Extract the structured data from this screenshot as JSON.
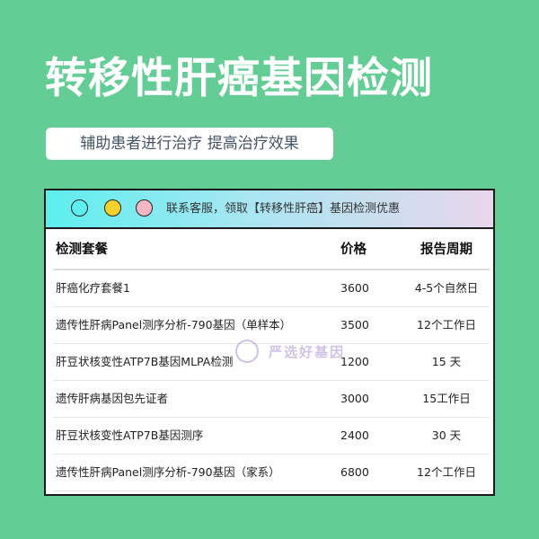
{
  "title": "转移性肝癌基因检测",
  "subtitle": "辅助患者进行治疗 提高治疗效果",
  "window": {
    "bar_text": "联系客服，领取【转移性肝癌】基因检测优惠"
  },
  "table": {
    "headers": [
      "检测套餐",
      "价格",
      "报告周期"
    ],
    "rows": [
      [
        "肝癌化疗套餐1",
        "3600",
        "4-5个自然日"
      ],
      [
        "遗传性肝病Panel测序分析-790基因（单样本）",
        "3500",
        "12个工作日"
      ],
      [
        "肝豆状核变性ATP7B基因MLPA检测",
        "1200",
        "15 天"
      ],
      [
        "遗传肝病基因包先证者",
        "3000",
        "15工作日"
      ],
      [
        "肝豆状核变性ATP7B基因测序",
        "2400",
        "30 天"
      ],
      [
        "遗传性肝病Panel测序分析-790基因（家系）",
        "6800",
        "12个工作日"
      ]
    ]
  },
  "watermark": {
    "text": "严选好基因"
  },
  "colors": {
    "background": "#63cd95",
    "dot_cyan": "#5deeee",
    "dot_yellow": "#f6d02d",
    "dot_pink": "#f6b6c4"
  }
}
